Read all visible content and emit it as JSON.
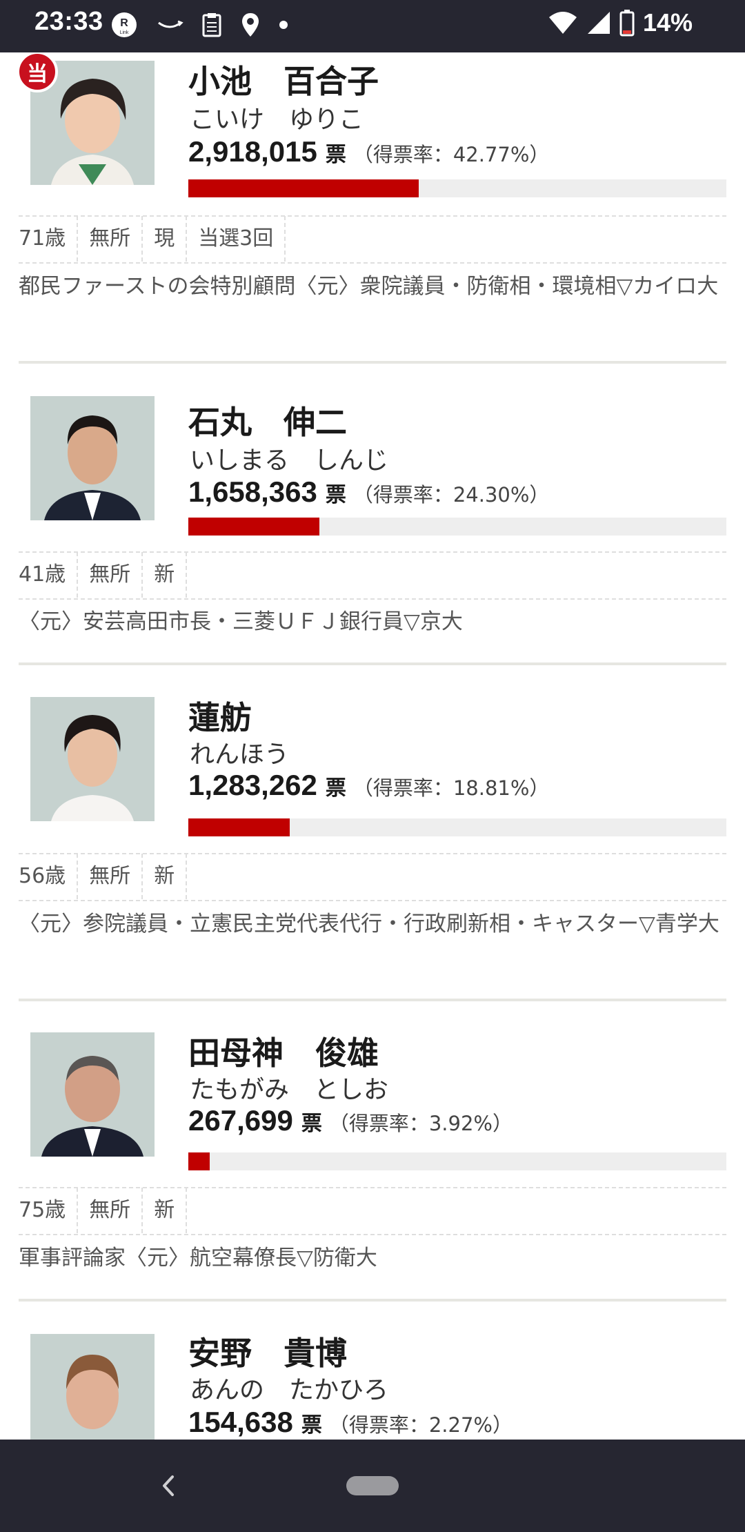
{
  "status_bar": {
    "time": "23:33",
    "battery_percent": "14%",
    "icons": [
      "r-link-icon",
      "smile-icon",
      "clipboard-icon",
      "location-icon",
      "dot-icon",
      "wifi-icon",
      "signal-icon",
      "battery-icon"
    ]
  },
  "winner_badge": "当",
  "vote_unit": "票",
  "bar_color": "#c00000",
  "candidates": [
    {
      "name": "小池　百合子",
      "kana": "こいけ　ゆりこ",
      "votes": "2,918,015",
      "rate_text": "（得票率：42.77%）",
      "rate": 42.77,
      "elected": true,
      "tags": [
        "71歳",
        "無所",
        "現",
        "当選3回"
      ],
      "profile": "都民ファーストの会特別顧問〈元〉衆院議員・防衛相・環境相▽カイロ大"
    },
    {
      "name": "石丸　伸二",
      "kana": "いしまる　しんじ",
      "votes": "1,658,363",
      "rate_text": "（得票率：24.30%）",
      "rate": 24.3,
      "elected": false,
      "tags": [
        "41歳",
        "無所",
        "新"
      ],
      "profile": "〈元〉安芸高田市長・三菱ＵＦＪ銀行員▽京大"
    },
    {
      "name": "蓮舫",
      "kana": "れんほう",
      "votes": "1,283,262",
      "rate_text": "（得票率：18.81%）",
      "rate": 18.81,
      "elected": false,
      "tags": [
        "56歳",
        "無所",
        "新"
      ],
      "profile": "〈元〉参院議員・立憲民主党代表代行・行政刷新相・キャスター▽青学大"
    },
    {
      "name": "田母神　俊雄",
      "kana": "たもがみ　としお",
      "votes": "267,699",
      "rate_text": "（得票率：3.92%）",
      "rate": 3.92,
      "elected": false,
      "tags": [
        "75歳",
        "無所",
        "新"
      ],
      "profile": "軍事評論家〈元〉航空幕僚長▽防衛大"
    },
    {
      "name": "安野　貴博",
      "kana": "あんの　たかひろ",
      "votes": "154,638",
      "rate_text": "（得票率：2.27%）",
      "rate": 2.27,
      "elected": false,
      "tags": [],
      "profile": ""
    }
  ]
}
